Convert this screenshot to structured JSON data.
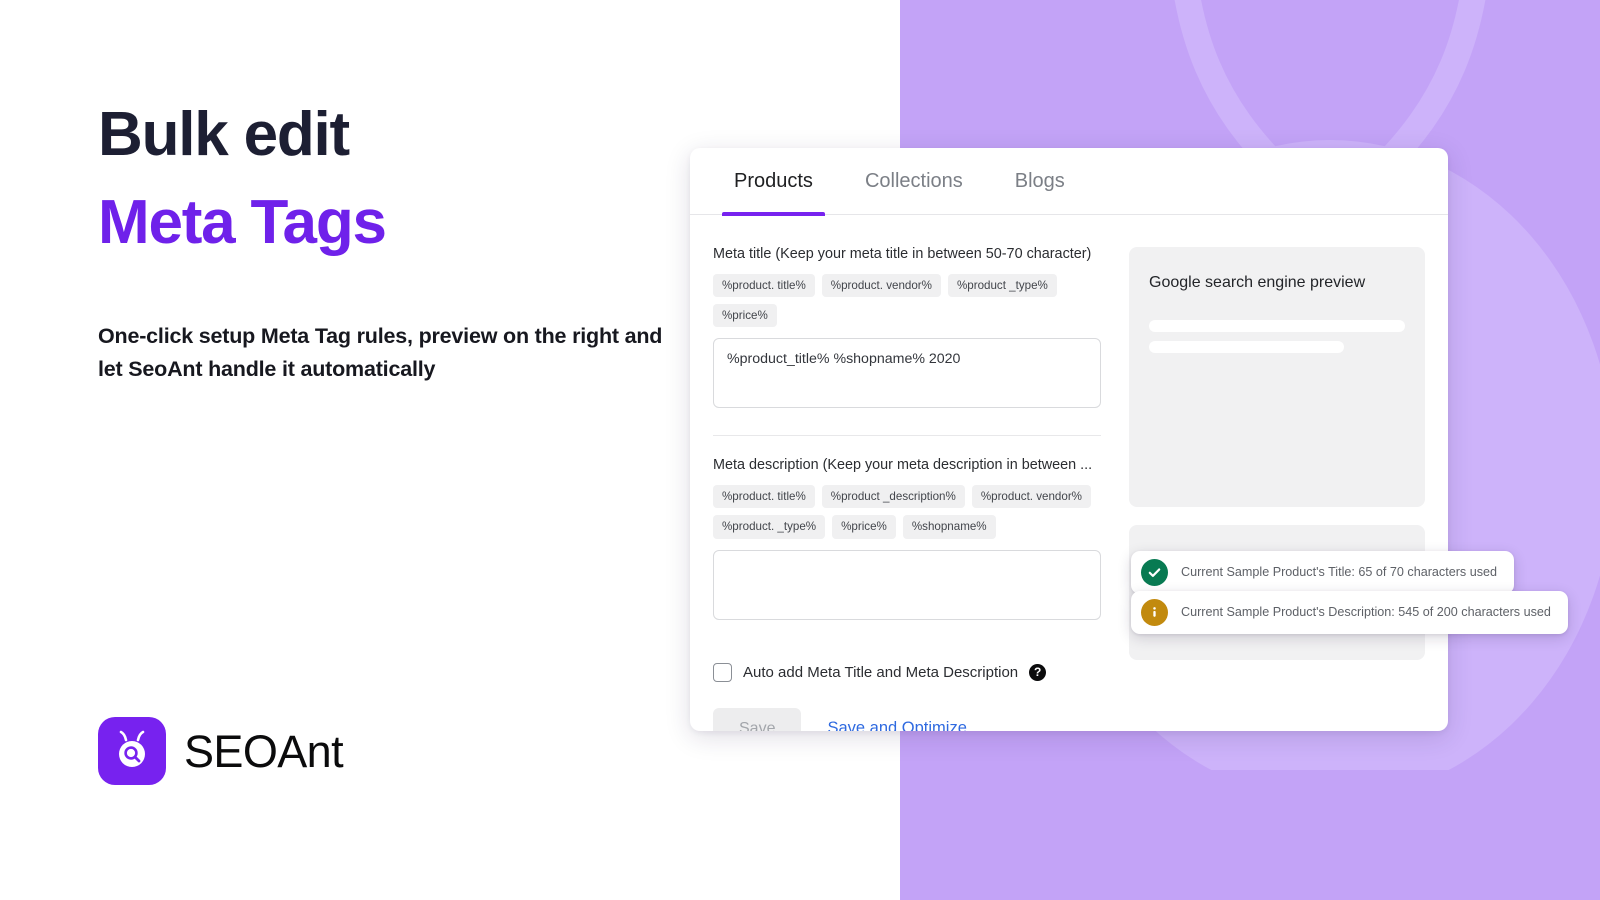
{
  "hero": {
    "line1": "Bulk edit",
    "line2": "Meta Tags",
    "subtitle": "One-click setup Meta Tag rules, preview on the right and let SeoAnt handle it automatically"
  },
  "brand": {
    "name": "SEOAnt",
    "mark_color": "#7722ef",
    "accent_color": "#6f21ea"
  },
  "theme": {
    "panel_purple": "#c3a3f7",
    "watermark_purple": "#cdb3fa",
    "accent": "#7722ef",
    "link_blue": "#2f6ae0",
    "success_green": "#087a52",
    "warning_amber": "#c28a0e"
  },
  "card": {
    "tabs": [
      {
        "label": "Products",
        "active": true
      },
      {
        "label": "Collections",
        "active": false
      },
      {
        "label": "Blogs",
        "active": false
      }
    ],
    "meta_title": {
      "label": "Meta title (Keep your meta title in between 50-70 character)",
      "chips": [
        "%product. title%",
        "%product. vendor%",
        "%product _type%",
        "%price%"
      ],
      "value": "%product_title% %shopname% 2020",
      "placeholder": ""
    },
    "meta_description": {
      "label": "Meta description (Keep your meta description in between ...",
      "chips": [
        "%product. title%",
        "%product _description%",
        "%product. vendor%",
        "%product. _type%",
        "%price%",
        "%shopname%"
      ],
      "value": "",
      "placeholder": ""
    },
    "auto_add": {
      "label": "Auto add Meta Title and Meta Description",
      "checked": false,
      "help_glyph": "?"
    },
    "buttons": {
      "save": "Save",
      "save_and_optimize": "Save and Optimize"
    },
    "preview": {
      "title": "Google search engine preview"
    }
  },
  "toasts": [
    {
      "status": "success",
      "glyph": "✔",
      "text": "Current Sample Product's Title: 65 of 70 characters used"
    },
    {
      "status": "warning",
      "glyph": "i",
      "text": "Current Sample Product's Description: 545 of 200 characters used"
    }
  ]
}
